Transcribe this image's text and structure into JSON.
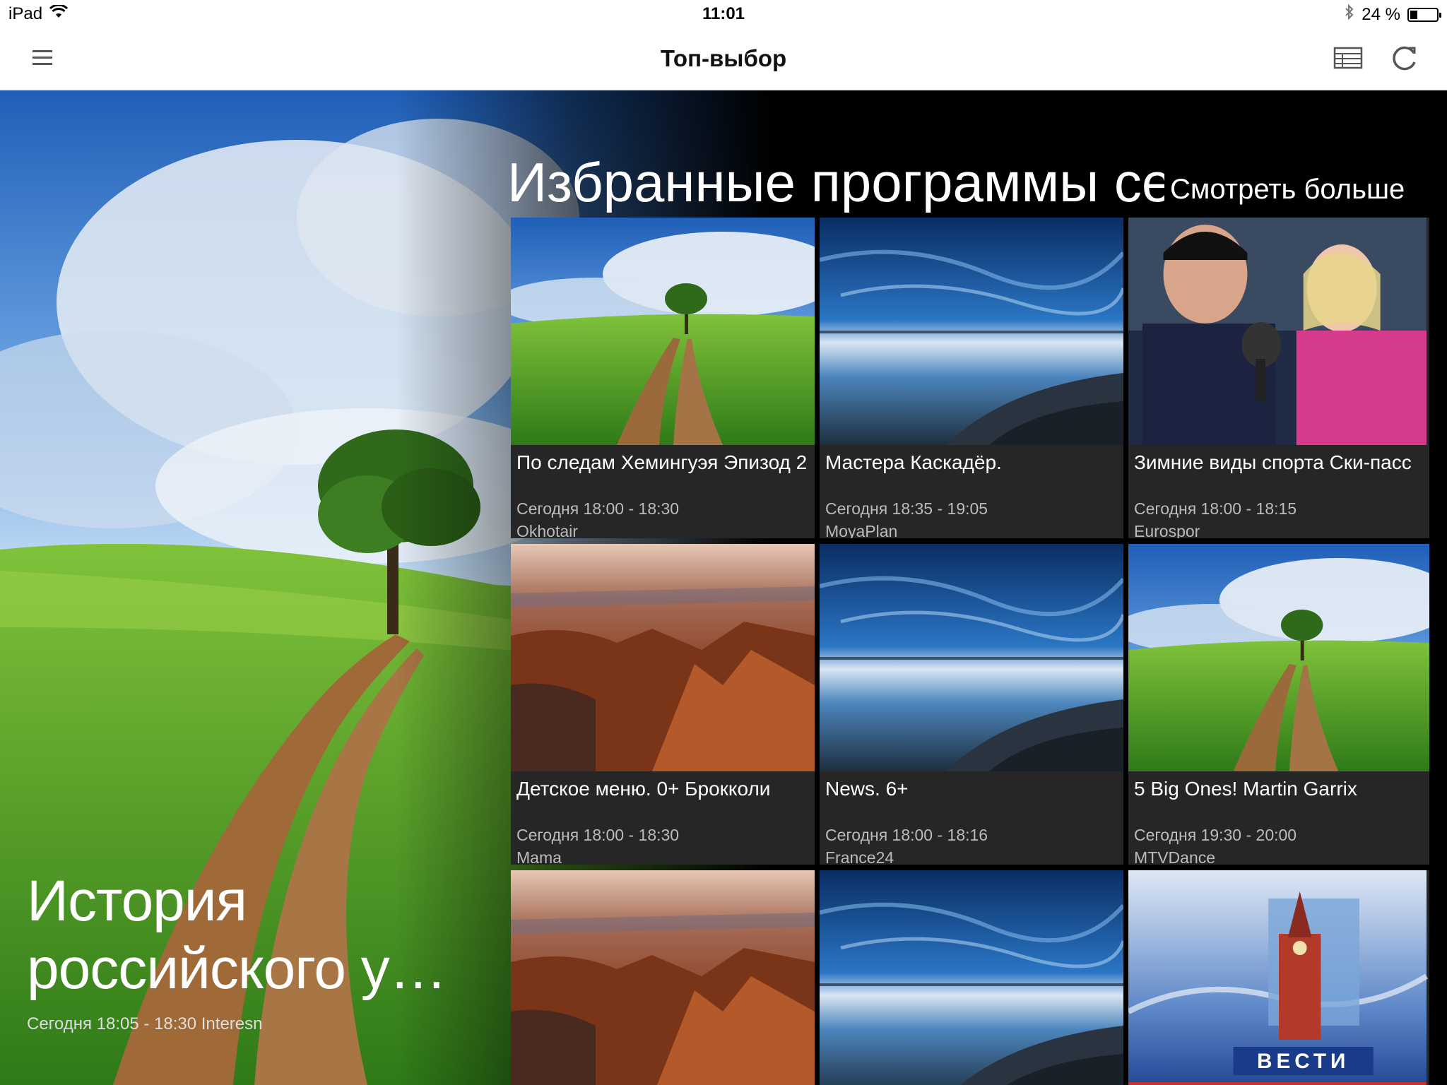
{
  "status": {
    "device": "iPad",
    "time": "11:01",
    "battery": "24 %",
    "battery_level": 0.24
  },
  "nav": {
    "title": "Топ-выбор",
    "menu_icon": "hamburger-icon",
    "list_icon": "list-view-icon",
    "refresh_icon": "refresh-icon"
  },
  "hero": {
    "title": "История российского у…",
    "subtitle": "Сегодня 18:05 - 18:30 Interesn"
  },
  "section": {
    "title": "Избранные программы сегодня",
    "see_more": "Смотреть больше"
  },
  "cards": [
    {
      "title": "По следам Хемингуэя Эпизод 2",
      "time": "Сегодня 18:00 - 18:30",
      "channel": "Okhotair",
      "image": "field-road"
    },
    {
      "title": "Мастера Каскадёр.",
      "time": "Сегодня 18:35 - 19:05",
      "channel": "MoyaPlan",
      "image": "sky-lake"
    },
    {
      "title": "Зимние виды спорта Ски-пасс",
      "time": "Сегодня 18:00 - 18:15",
      "channel": "Eurospor",
      "image": "interview"
    },
    {
      "title": "Детское меню. 0+ Брокколи",
      "time": "Сегодня 18:00 - 18:30",
      "channel": "Mama",
      "image": "canyon"
    },
    {
      "title": "News. 6+",
      "time": "Сегодня 18:00 - 18:16",
      "channel": "France24",
      "image": "sky-lake"
    },
    {
      "title": "5 Big Ones! Martin Garrix",
      "time": "Сегодня 19:30 - 20:00",
      "channel": "MTVDance",
      "image": "field-road"
    },
    {
      "title": "",
      "time": "",
      "channel": "",
      "image": "canyon"
    },
    {
      "title": "",
      "time": "",
      "channel": "",
      "image": "sky-lake"
    },
    {
      "title": "",
      "time": "",
      "channel": "",
      "image": "vesti-kremlin"
    }
  ],
  "vesti_logo": "ВЕСТИ"
}
